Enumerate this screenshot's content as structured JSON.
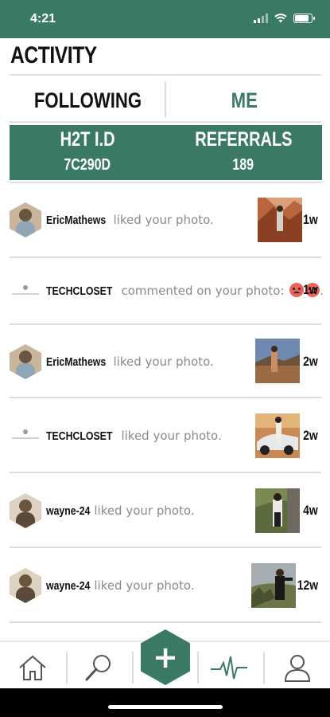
{
  "status_bar": {
    "time": "4:21"
  },
  "page": {
    "title": "ACTIVITY"
  },
  "tabs": {
    "following": "FOLLOWING",
    "me": "ME",
    "active": "me"
  },
  "id_panel": {
    "id_label": "H2T I.D",
    "id_value": "7C290D",
    "referrals_label": "REFERRALS",
    "referrals_value": "189"
  },
  "activity": [
    {
      "user": "EricMathews",
      "action": "liked your photo.",
      "time": "1w",
      "avatar": "eric",
      "has_thumb": true
    },
    {
      "user": "TECHCLOSET",
      "action": "commented on your photo:",
      "emoji_suffix": ".",
      "time": "1w",
      "avatar": "techcloset",
      "has_thumb": false
    },
    {
      "user": "EricMathews",
      "action": "liked your photo.",
      "time": "2w",
      "avatar": "eric",
      "has_thumb": true
    },
    {
      "user": "TECHCLOSET",
      "action": "liked your photo.",
      "time": "2w",
      "avatar": "techcloset",
      "has_thumb": true
    },
    {
      "user": "wayne-24",
      "action": "liked your photo.",
      "time": "4w",
      "avatar": "wayne",
      "has_thumb": true
    },
    {
      "user": "wayne-24",
      "action": "liked your photo.",
      "time": "12w",
      "avatar": "wayne",
      "has_thumb": true
    }
  ],
  "tab_bar": {
    "items": [
      "home-icon",
      "search-icon",
      "add-icon",
      "activity-pulse-icon",
      "profile-icon"
    ],
    "active": "activity-pulse-icon"
  },
  "colors": {
    "brand_green": "#3b7a62",
    "divider": "#dcdcdc"
  }
}
